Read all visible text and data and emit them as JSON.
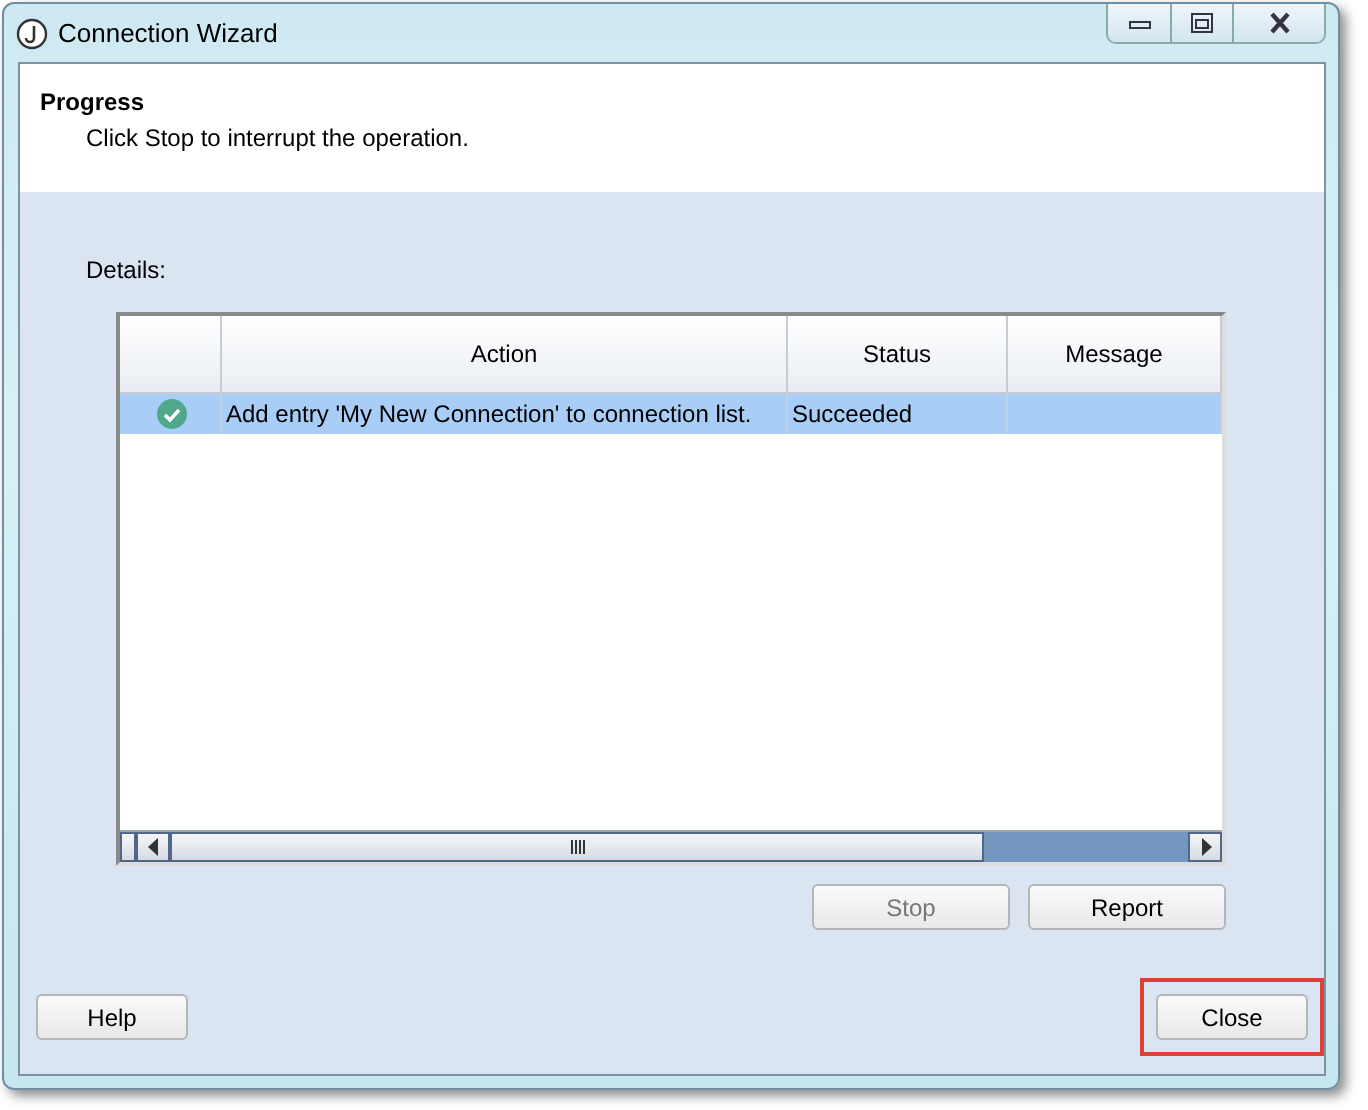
{
  "window": {
    "title": "Connection Wizard"
  },
  "header": {
    "title": "Progress",
    "subtitle": "Click Stop to interrupt the operation."
  },
  "details_label": "Details:",
  "table": {
    "columns": [
      "",
      "Action",
      "Status",
      "Message"
    ],
    "rows": [
      {
        "kind": "success",
        "action": "Add entry 'My New Connection' to connection list.",
        "status": "Succeeded",
        "selected": true
      }
    ]
  },
  "table_buttons": [
    {
      "label": "Stop",
      "disabled": true
    },
    {
      "label": "Report",
      "disabled": false
    }
  ],
  "footer_buttons": [
    {
      "label": "Help",
      "highlighted": false
    },
    {
      "label": "Close",
      "highlighted": true
    }
  ]
}
